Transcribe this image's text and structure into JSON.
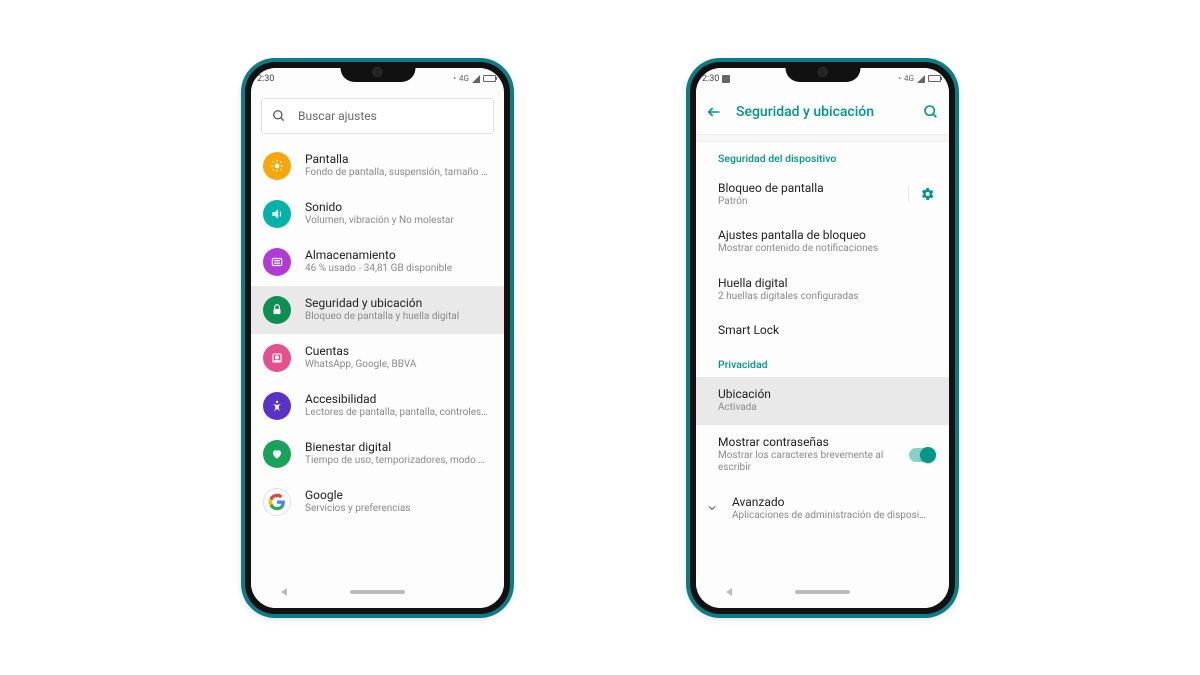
{
  "colors": {
    "accent": "#009688"
  },
  "status": {
    "time": "2:30",
    "net_label": "4G"
  },
  "phone1": {
    "search_placeholder": "Buscar ajustes",
    "items": [
      {
        "title": "Pantalla",
        "subtitle": "Fondo de pantalla, suspensión, tamaño d…",
        "icon": "display-icon",
        "color": "ic-orange"
      },
      {
        "title": "Sonido",
        "subtitle": "Volumen, vibración y No molestar",
        "icon": "sound-icon",
        "color": "ic-teal"
      },
      {
        "title": "Almacenamiento",
        "subtitle": "46 % usado - 34,81 GB disponible",
        "icon": "storage-icon",
        "color": "ic-purple"
      },
      {
        "title": "Seguridad y ubicación",
        "subtitle": "Bloqueo de pantalla y huella digital",
        "icon": "lock-icon",
        "color": "ic-green",
        "highlight": true
      },
      {
        "title": "Cuentas",
        "subtitle": "WhatsApp, Google, BBVA",
        "icon": "account-icon",
        "color": "ic-pink"
      },
      {
        "title": "Accesibilidad",
        "subtitle": "Lectores de pantalla, pantalla, controles d…",
        "icon": "accessibility-icon",
        "color": "ic-indigo"
      },
      {
        "title": "Bienestar digital",
        "subtitle": "Tiempo de uso, temporizadores, modo De…",
        "icon": "wellbeing-icon",
        "color": "ic-green2"
      },
      {
        "title": "Google",
        "subtitle": "Servicios y preferencias",
        "icon": "google-icon",
        "color": "ic-white"
      }
    ]
  },
  "phone2": {
    "title": "Seguridad y ubicación",
    "section1": "Seguridad del dispositivo",
    "rows1": [
      {
        "title": "Bloqueo de pantalla",
        "subtitle": "Patrón",
        "gear": true
      },
      {
        "title": "Ajustes pantalla de bloqueo",
        "subtitle": "Mostrar contenido de notificaciones"
      },
      {
        "title": "Huella digital",
        "subtitle": "2 huellas digitales configuradas"
      },
      {
        "title": "Smart Lock",
        "subtitle": ""
      }
    ],
    "section2": "Privacidad",
    "rows2": [
      {
        "title": "Ubicación",
        "subtitle": "Activada",
        "highlight": true
      },
      {
        "title": "Mostrar contraseñas",
        "subtitle": "Mostrar los caracteres brevemente al escribir",
        "toggle": true
      }
    ],
    "advanced": {
      "title": "Avanzado",
      "subtitle": "Aplicaciones de administración de disposi…"
    }
  }
}
